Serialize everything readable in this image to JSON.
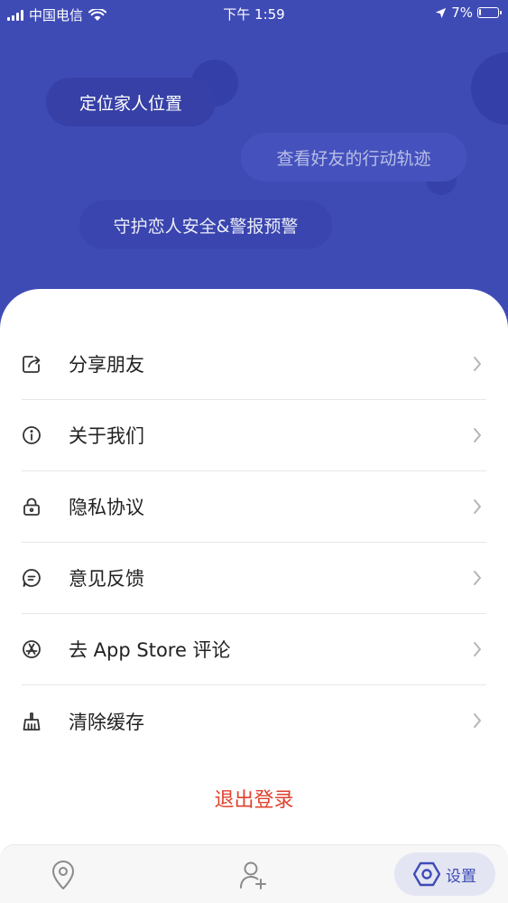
{
  "status_bar": {
    "carrier": "中国电信",
    "time": "下午 1:59",
    "battery": "7%",
    "battery_level": 0.07
  },
  "hero": {
    "bubbles": [
      "定位家人位置",
      "查看好友的行动轨迹",
      "守护恋人安全&警报预警"
    ]
  },
  "menu": {
    "items": [
      {
        "label": "分享朋友",
        "icon": "share-icon"
      },
      {
        "label": "关于我们",
        "icon": "info-icon"
      },
      {
        "label": "隐私协议",
        "icon": "lock-icon"
      },
      {
        "label": "意见反馈",
        "icon": "feedback-icon"
      },
      {
        "label": "去 App Store 评论",
        "icon": "app-store-icon"
      },
      {
        "label": "清除缓存",
        "icon": "broom-icon"
      }
    ]
  },
  "logout_label": "退出登录",
  "tabbar": {
    "tabs": [
      {
        "icon": "location-pin-icon"
      },
      {
        "icon": "add-friend-icon"
      },
      {
        "icon": "settings-icon",
        "label": "设置",
        "active": true
      }
    ]
  },
  "colors": {
    "brand": "#3f4bb5",
    "logout": "#e0422e",
    "active_tab_bg": "#e3e5f3"
  }
}
